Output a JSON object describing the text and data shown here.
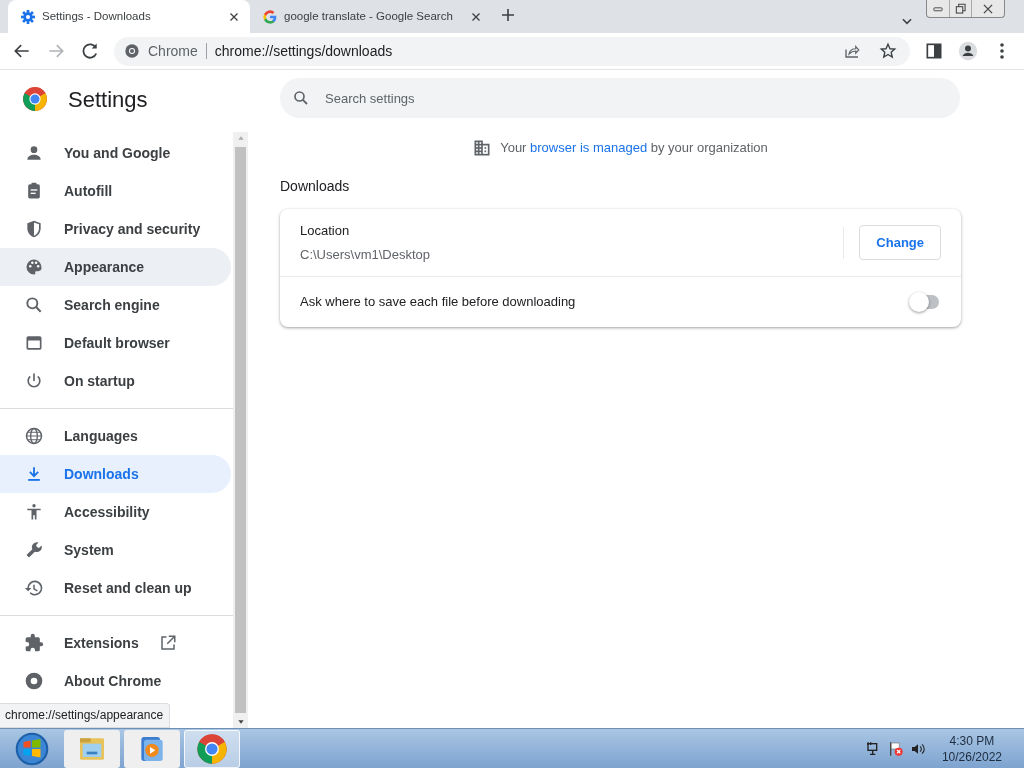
{
  "tabs": [
    {
      "title": "Settings - Downloads",
      "selected": true
    },
    {
      "title": "google translate - Google Search",
      "selected": false
    }
  ],
  "address_bar": {
    "site_label": "Chrome",
    "url": "chrome://settings/downloads"
  },
  "settings": {
    "title": "Settings",
    "search_placeholder": "Search settings"
  },
  "sidebar": {
    "groups": [
      {
        "items": [
          {
            "label": "You and Google",
            "selected": false,
            "hovered": false
          },
          {
            "label": "Autofill",
            "selected": false,
            "hovered": false
          },
          {
            "label": "Privacy and security",
            "selected": false,
            "hovered": false
          },
          {
            "label": "Appearance",
            "selected": false,
            "hovered": true
          },
          {
            "label": "Search engine",
            "selected": false,
            "hovered": false
          },
          {
            "label": "Default browser",
            "selected": false,
            "hovered": false
          },
          {
            "label": "On startup",
            "selected": false,
            "hovered": false
          }
        ]
      },
      {
        "items": [
          {
            "label": "Languages",
            "selected": false,
            "hovered": false
          },
          {
            "label": "Downloads",
            "selected": true,
            "hovered": false
          },
          {
            "label": "Accessibility",
            "selected": false,
            "hovered": false
          },
          {
            "label": "System",
            "selected": false,
            "hovered": false
          },
          {
            "label": "Reset and clean up",
            "selected": false,
            "hovered": false
          }
        ]
      },
      {
        "items": [
          {
            "label": "Extensions",
            "selected": false,
            "hovered": false,
            "external": true
          },
          {
            "label": "About Chrome",
            "selected": false,
            "hovered": false
          }
        ]
      }
    ]
  },
  "managed_notice": {
    "before": "Your",
    "link": "browser is managed",
    "after": "by your organization"
  },
  "section_title": "Downloads",
  "location": {
    "label": "Location",
    "value": "C:\\Users\\vm1\\Desktop",
    "button": "Change"
  },
  "ask_toggle": {
    "label": "Ask where to save each file before downloading",
    "on": false
  },
  "status_tooltip": "chrome://settings/appearance",
  "taskbar": {
    "apps": [
      {
        "kind": "explorer",
        "active": false
      },
      {
        "kind": "media",
        "active": false
      },
      {
        "kind": "chrome",
        "active": true
      }
    ],
    "time": "4:30 PM",
    "date": "10/26/2022"
  }
}
